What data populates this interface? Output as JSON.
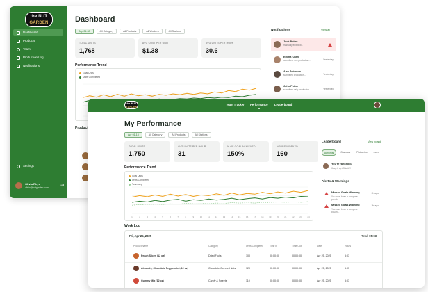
{
  "back": {
    "logo": {
      "line1": "the NUT",
      "line2": "GARDEN"
    },
    "nav": [
      {
        "label": "Dashboard",
        "icon": "grid-icon",
        "active": true
      },
      {
        "label": "Products",
        "icon": "box-icon",
        "active": false
      },
      {
        "label": "Team",
        "icon": "users-icon",
        "active": false
      },
      {
        "label": "Production Log",
        "icon": "list-icon",
        "active": false
      },
      {
        "label": "Notifications",
        "icon": "bell-icon",
        "active": false
      }
    ],
    "settings": "Settings",
    "user": {
      "name": "Olivia Rhye",
      "email": "olivia@nutgarden.com",
      "logout_icon": "logout-icon"
    },
    "title": "Dashboard",
    "filters": [
      "Sep 01-30",
      "All Category",
      "All Products",
      "All Workers",
      "All Stations"
    ],
    "kpis": [
      {
        "label": "TOTAL UNITS",
        "value": "1,768"
      },
      {
        "label": "AVG COST PER UNIT",
        "value": "$1.38"
      },
      {
        "label": "AVG UNITS PER HOUR",
        "value": "30.6"
      }
    ],
    "trend_title": "Performance Trend",
    "legend": [
      "Goal Units",
      "Units Completed"
    ],
    "products_title": "Product",
    "notifications": {
      "title": "Notifications",
      "view_all": "View all",
      "items": [
        {
          "name": "Jack Potter",
          "text": "manually edited w...",
          "time": "",
          "alert": true
        },
        {
          "name": "Emma Chen",
          "text": "submitted new production...",
          "time": "Yesterday",
          "alert": false
        },
        {
          "name": "Alex Johnson",
          "text": "submitted production...",
          "time": "Yesterday",
          "alert": false
        },
        {
          "name": "John Potter",
          "text": "submitted daily production...",
          "time": "Yesterday",
          "alert": false
        }
      ]
    }
  },
  "front": {
    "logo": {
      "line1": "the NUT",
      "line2": "GARDEN"
    },
    "nav": [
      "Team Tracker",
      "Performance",
      "Leaderboard"
    ],
    "active_nav": "Performance",
    "title": "My Performance",
    "filters": [
      "Apr 01-15",
      "All Category",
      "All Products",
      "All Stations"
    ],
    "kpis": [
      {
        "label": "TOTAL UNITS",
        "value": "1,750"
      },
      {
        "label": "AVG UNITS PER HOUR",
        "value": "31"
      },
      {
        "label": "% OF GOAL ACHIEVED",
        "value": "150%"
      },
      {
        "label": "HOURS WORKED",
        "value": "160"
      }
    ],
    "trend_title": "Performance Trend",
    "legend": [
      "Goal Units",
      "Units Completed",
      "Team avg"
    ],
    "leaderboard": {
      "title": "Leaderboard",
      "view_board": "View board",
      "tabs": [
        "Almonds",
        "Cashews",
        "Pistachios",
        "more"
      ],
      "item_title": "You're ranked #3",
      "item_sub": "Keep it up #3 to #2!"
    },
    "alerts": {
      "title": "Alerts & Warnings",
      "items": [
        {
          "title": "Missed Goals Warning",
          "text": "You have been a complete pouch...",
          "time": "2h ago"
        },
        {
          "title": "Missed Goals Warning",
          "text": "You have been a complete pouch...",
          "time": "3h ago"
        }
      ]
    },
    "worklog": {
      "title": "Work Log",
      "date": "Fri, Apr 25, 2025",
      "total_label": "Total:",
      "total_value": "05:03",
      "headers": [
        "Product name",
        "Category",
        "Units Completed",
        "Time In",
        "Time Out",
        "Date",
        "Hours"
      ],
      "rows": [
        {
          "product": "Peach Slices (12 oz)",
          "category": "Dried Fruits",
          "units": "100",
          "in": "00:00:00",
          "out": "00:00:00",
          "date": "Apr 25, 2025",
          "hours": "5:03"
        },
        {
          "product": "Almonds, Chocolate Peppermint (12 oz)",
          "category": "Chocolate Covered Nuts",
          "units": "120",
          "in": "00:00:00",
          "out": "00:00:00",
          "date": "Apr 25, 2025",
          "hours": "5:03"
        },
        {
          "product": "Gummy Mix (12 oz)",
          "category": "Candy & Sweets",
          "units": "110",
          "in": "00:00:00",
          "out": "00:00:00",
          "date": "Apr 25, 2025",
          "hours": "5:03"
        }
      ]
    }
  },
  "colors": {
    "brand": "#2e7d32",
    "goal": "#f0a11c",
    "units": "#2e7d32",
    "team": "#9ccf9c",
    "alert": "#d64545"
  },
  "chart_data": [
    {
      "type": "line",
      "title": "Performance Trend",
      "series": [
        {
          "name": "Goal Units",
          "values": [
            40,
            44,
            41,
            46,
            42,
            47,
            43,
            48,
            44,
            46,
            43,
            47,
            45,
            48,
            46,
            49,
            47,
            50,
            48,
            52,
            50,
            55,
            53,
            58,
            56,
            60
          ]
        },
        {
          "name": "Units Completed",
          "values": [
            30,
            34,
            31,
            33,
            32,
            35,
            33,
            36,
            34,
            35,
            33,
            37,
            35,
            36,
            38,
            37,
            39,
            38,
            40,
            39,
            41,
            40,
            43,
            42,
            45,
            47
          ]
        }
      ],
      "grid": true
    },
    {
      "type": "line",
      "title": "Performance Trend",
      "x": [
        "1",
        "2",
        "3",
        "4",
        "5",
        "6",
        "7",
        "8",
        "9",
        "10",
        "11",
        "12",
        "13",
        "14",
        "15",
        "16",
        "17",
        "18",
        "19",
        "20",
        "21",
        "22",
        "23",
        "24"
      ],
      "series": [
        {
          "name": "Goal Units",
          "values": [
            44,
            48,
            45,
            50,
            46,
            52,
            47,
            51,
            46,
            50,
            48,
            53,
            49,
            55,
            50,
            54,
            52,
            57,
            53,
            58,
            55,
            60,
            57,
            62
          ]
        },
        {
          "name": "Units Completed",
          "values": [
            30,
            33,
            31,
            35,
            32,
            36,
            38,
            33,
            37,
            35,
            39,
            36,
            38,
            41,
            37,
            40,
            42,
            39,
            43,
            41,
            44,
            42,
            46,
            45
          ]
        },
        {
          "name": "Team avg",
          "values": [
            22,
            24,
            23,
            25,
            24,
            26,
            25,
            27,
            26,
            27,
            26,
            28,
            27,
            29,
            28,
            29,
            28,
            30,
            29,
            31,
            30,
            31,
            30,
            32
          ]
        }
      ],
      "grid": true
    }
  ]
}
